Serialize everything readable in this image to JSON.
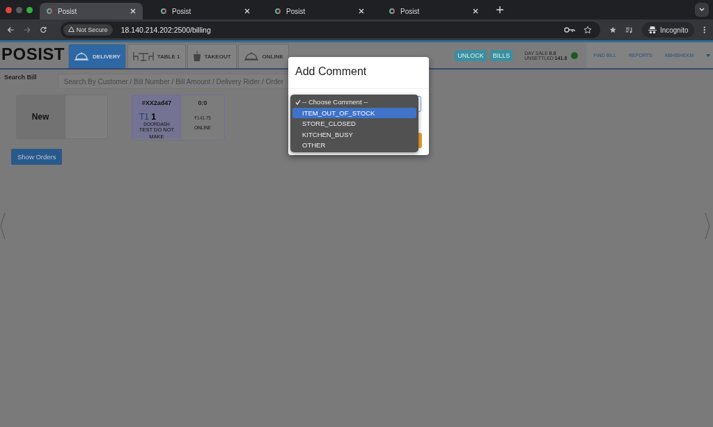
{
  "browser": {
    "tabs": [
      {
        "title": "Posist",
        "selected": true
      },
      {
        "title": "Posist",
        "selected": false
      },
      {
        "title": "Posist",
        "selected": false
      },
      {
        "title": "Posist",
        "selected": false
      }
    ],
    "security": "Not Secure",
    "url": "18.140.214.202:2500/billing",
    "profile": "Incognito"
  },
  "app": {
    "logo": "POSIST",
    "tabs": [
      {
        "label": "DELIVERY",
        "kind": "bell",
        "selected": true
      },
      {
        "label": "TABLE 1",
        "kind": "table",
        "selected": false
      },
      {
        "label": "TAKEOUT",
        "kind": "bag",
        "selected": false
      },
      {
        "label": "ONLINE",
        "kind": "bell",
        "selected": false
      }
    ],
    "buttons": [
      "UNLOCK",
      "BILLS"
    ],
    "day_sale_label": "DAY SALE",
    "day_sale": "0.0",
    "unsettled_label": "UNSETTLED:",
    "unsettled": "141.8",
    "nav": [
      "FIND BILL",
      "REPORTS"
    ],
    "user": "ABHISHEKM",
    "search": {
      "label": "Search Bill",
      "placeholder": "Search By Customer / Bill Number / Bill Amount / Delivery Rider / Order"
    },
    "new_card": "New",
    "order": {
      "number": "#XX2ad47",
      "table": "T1",
      "count": "1",
      "source": "DOORDASH",
      "note": "TEST DO NOT MAKE",
      "time": "0:0",
      "amount": "₹141.75",
      "payment": "ONLINE"
    },
    "show_orders": "Show Orders"
  },
  "modal": {
    "title": "Add Comment",
    "options": [
      {
        "label": "-- Choose Comment --",
        "selected": true,
        "highlighted": false
      },
      {
        "label": "ITEM_OUT_OF_STOCK",
        "selected": false,
        "highlighted": true
      },
      {
        "label": "STORE_CLOSED",
        "selected": false,
        "highlighted": false
      },
      {
        "label": "KITCHEN_BUSY",
        "selected": false,
        "highlighted": false
      },
      {
        "label": "OTHER",
        "selected": false,
        "highlighted": false
      }
    ]
  }
}
